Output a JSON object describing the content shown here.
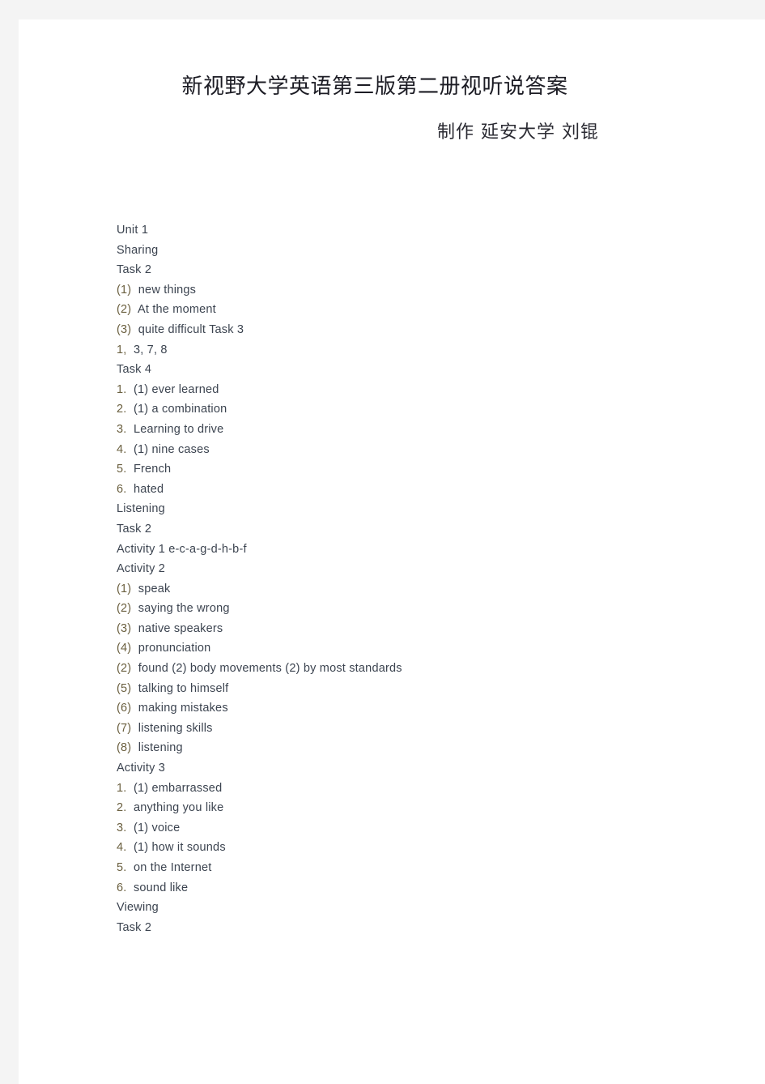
{
  "document": {
    "title": "新视野大学英语第三版第二册视听说答案",
    "byline": "制作 延安大学 刘锟",
    "lines": [
      {
        "marker": "",
        "text": "Unit 1"
      },
      {
        "marker": "",
        "text": "Sharing"
      },
      {
        "marker": "",
        "text": "Task 2"
      },
      {
        "marker": "(1)",
        "text": "  new things"
      },
      {
        "marker": "(2)",
        "text": "  At the moment"
      },
      {
        "marker": "(3)",
        "text": "  quite difficult Task 3"
      },
      {
        "marker": "1,",
        "text": "  3, 7, 8"
      },
      {
        "marker": "",
        "text": "Task 4"
      },
      {
        "marker": "1.",
        "text": "  (1) ever learned"
      },
      {
        "marker": "2.",
        "text": "  (1) a combination"
      },
      {
        "marker": "3.",
        "text": "  Learning to drive"
      },
      {
        "marker": "4.",
        "text": "  (1) nine cases"
      },
      {
        "marker": "5.",
        "text": "  French"
      },
      {
        "marker": "6.",
        "text": "  hated"
      },
      {
        "marker": "",
        "text": "Listening"
      },
      {
        "marker": "",
        "text": "Task 2"
      },
      {
        "marker": "",
        "text": "Activity 1 e-c-a-g-d-h-b-f"
      },
      {
        "marker": "",
        "text": "Activity 2"
      },
      {
        "marker": "(1)",
        "text": "  speak"
      },
      {
        "marker": "(2)",
        "text": "  saying the wrong"
      },
      {
        "marker": "(3)",
        "text": "  native speakers"
      },
      {
        "marker": "(4)",
        "text": "  pronunciation"
      },
      {
        "marker": "(2)",
        "text": "  found (2) body movements (2) by most standards"
      },
      {
        "marker": "(5)",
        "text": "  talking to himself"
      },
      {
        "marker": "(6)",
        "text": "  making mistakes"
      },
      {
        "marker": "(7)",
        "text": "  listening skills"
      },
      {
        "marker": "(8)",
        "text": "  listening"
      },
      {
        "marker": "",
        "text": "Activity 3"
      },
      {
        "marker": "1.",
        "text": "  (1) embarrassed"
      },
      {
        "marker": "2.",
        "text": "  anything you like"
      },
      {
        "marker": "3.",
        "text": "  (1) voice"
      },
      {
        "marker": "4.",
        "text": "  (1) how it sounds"
      },
      {
        "marker": "5.",
        "text": "  on the Internet"
      },
      {
        "marker": "6.",
        "text": "  sound like"
      },
      {
        "marker": "",
        "text": "Viewing"
      },
      {
        "marker": "",
        "text": "Task 2"
      }
    ]
  },
  "colors": {
    "page_background": "#ffffff",
    "scan_margin": "#f4f4f4",
    "body_text": "#3c4450",
    "marker_text": "#6b6040",
    "title_text": "#1c1c24"
  }
}
